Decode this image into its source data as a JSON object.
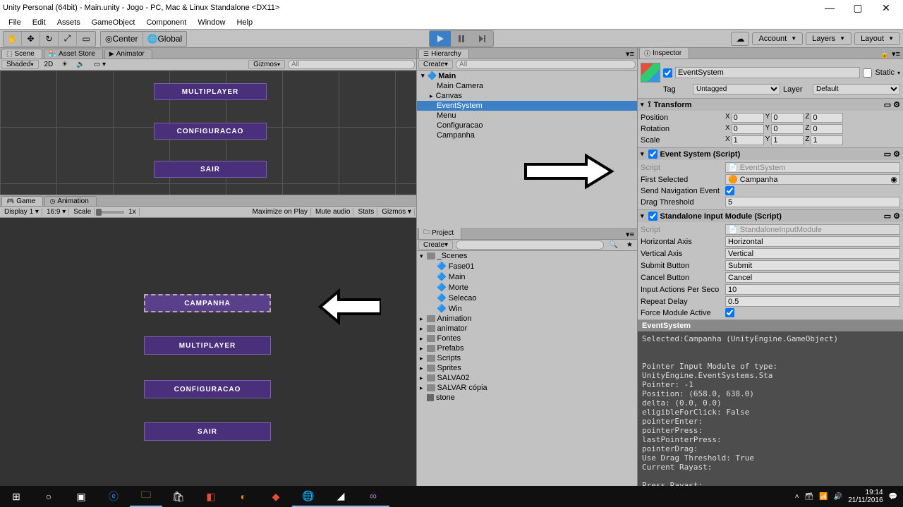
{
  "window": {
    "title": "Unity Personal (64bit) - Main.unity - Jogo - PC, Mac & Linux Standalone <DX11>"
  },
  "menu": [
    "File",
    "Edit",
    "Assets",
    "GameObject",
    "Component",
    "Window",
    "Help"
  ],
  "toolbar": {
    "pivot": "Center",
    "space": "Global",
    "right": {
      "account": "Account",
      "layers": "Layers",
      "layout": "Layout"
    }
  },
  "scene": {
    "tabs": {
      "scene": "Scene",
      "asset_store": "Asset Store",
      "animator": "Animator"
    },
    "shading": "Shaded",
    "twod": "2D",
    "gizmos": "Gizmos",
    "search_ph": "All",
    "buttons": {
      "multi": "MULTIPLAYER",
      "config": "CONFIGURACAO",
      "sair": "SAIR"
    }
  },
  "game": {
    "tabs": {
      "game": "Game",
      "animation": "Animation"
    },
    "subbar": {
      "display": "Display 1",
      "aspect": "16:9",
      "scale": "Scale",
      "scale_val": "1x",
      "maximize": "Maximize on Play",
      "mute": "Mute audio",
      "stats": "Stats",
      "gizmos": "Gizmos"
    },
    "buttons": {
      "campanha": "CAMPANHA",
      "multi": "MULTIPLAYER",
      "config": "CONFIGURACAO",
      "sair": "SAIR"
    }
  },
  "hierarchy": {
    "tab": "Hierarchy",
    "create": "Create",
    "search_ph": "All",
    "root": "Main",
    "items": [
      "Main Camera",
      "Canvas",
      "EventSystem",
      "Menu",
      "Configuracao",
      "Campanha"
    ]
  },
  "project": {
    "tab": "Project",
    "create": "Create",
    "scenes_folder": "_Scenes",
    "scenes": [
      "Fase01",
      "Main",
      "Morte",
      "Selecao",
      "Win"
    ],
    "folders": [
      "Animation",
      "animator",
      "Fontes",
      "Prefabs",
      "Scripts",
      "Sprites",
      "SALVA02",
      "SALVAR cópia"
    ],
    "asset": "stone"
  },
  "inspector": {
    "tab": "Inspector",
    "name": "EventSystem",
    "static": "Static",
    "tag_label": "Tag",
    "tag": "Untagged",
    "layer_label": "Layer",
    "layer": "Default",
    "transform": {
      "title": "Transform",
      "pos_label": "Position",
      "rot_label": "Rotation",
      "scale_label": "Scale",
      "pos": {
        "x": "0",
        "y": "0",
        "z": "0"
      },
      "rot": {
        "x": "0",
        "y": "0",
        "z": "0"
      },
      "scl": {
        "x": "1",
        "y": "1",
        "z": "1"
      }
    },
    "event_system": {
      "title": "Event System (Script)",
      "script_label": "Script",
      "script": "EventSystem",
      "first_label": "First Selected",
      "first": "Campanha",
      "nav_label": "Send Navigation Event",
      "nav": true,
      "drag_label": "Drag Threshold",
      "drag": "5"
    },
    "input_module": {
      "title": "Standalone Input Module (Script)",
      "script_label": "Script",
      "script": "StandaloneInputModule",
      "horiz_label": "Horizontal Axis",
      "horiz": "Horizontal",
      "vert_label": "Vertical Axis",
      "vert": "Vertical",
      "submit_label": "Submit Button",
      "submit": "Submit",
      "cancel_label": "Cancel Button",
      "cancel": "Cancel",
      "persec_label": "Input Actions Per Seco",
      "persec": "10",
      "repeat_label": "Repeat Delay",
      "repeat": "0.5",
      "force_label": "Force Module Active",
      "force": true
    },
    "debug": {
      "head": "EventSystem",
      "body": "Selected:Campanha (UnityEngine.GameObject)\n\n\nPointer Input Module of type: UnityEngine.EventSystems.Sta\nPointer: -1\nPosition: (658.0, 638.0)\ndelta: (0.0, 0.0)\neligibleForClick: False\npointerEnter:\npointerPress:\nlastPointerPress:\npointerDrag:\nUse Drag Threshold: True\nCurrent Rayast:\n\nPress Rayast:"
    }
  },
  "taskbar": {
    "time": "19:14",
    "date": "21/11/2016"
  }
}
